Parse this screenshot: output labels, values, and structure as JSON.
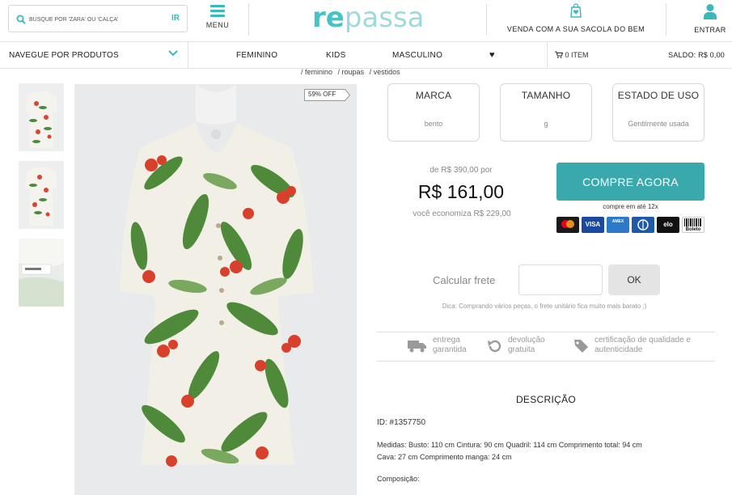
{
  "header": {
    "search_placeholder": "BUSQUE POR 'ZARA' OU 'CALÇA'",
    "search_go": "IR",
    "menu_label": "MENU",
    "logo_re": "re",
    "logo_rest": "passa",
    "sell_label": "VENDA COM A SUA SACOLA DO BEM",
    "login_label": "ENTRAR"
  },
  "nav": {
    "browse_label": "NAVEGUE POR PRODUTOS",
    "items": [
      "FEMININO",
      "KIDS",
      "MASCULINO"
    ],
    "cart_label": "0 ITEM",
    "balance_label": "SALDO: R$ 0,00"
  },
  "breadcrumb": [
    "/ feminino",
    "/ roupas",
    "/ vestidos"
  ],
  "product": {
    "discount_badge": "59% OFF",
    "attributes": [
      {
        "title": "MARCA",
        "value": "bento"
      },
      {
        "title": "TAMANHO",
        "value": "g"
      },
      {
        "title": "ESTADO DE USO",
        "value": "Gentilmente usada"
      }
    ],
    "old_price": "de R$ 390,00 por",
    "price": "R$ 161,00",
    "savings": "você economiza R$ 229,00",
    "buy_label": "COMPRE AGORA",
    "installments": "compre em até 12x",
    "payment_methods": [
      "MC",
      "VISA",
      "AMEX",
      "DINERS",
      "elo",
      "Boleto"
    ]
  },
  "shipping": {
    "label": "Calcular frete",
    "ok_label": "OK",
    "tip": "Dica: Comprando vários peças, o frete unitário fica muito mais barato ;)"
  },
  "benefits": [
    {
      "line1": "entrega",
      "line2": "garantida",
      "icon": "truck-icon"
    },
    {
      "line1": "devolução",
      "line2": "gratuita",
      "icon": "return-icon"
    },
    {
      "line1": "certificação de qualidade e",
      "line2": "autenticidade",
      "icon": "tag-icon"
    }
  ],
  "description": {
    "title": "DESCRIÇÃO",
    "id": "ID: #1357750",
    "measures_1": "Medidas: Busto: 110 cm Cintura: 90 cm Quadril: 114 cm Comprimento total: 94 cm",
    "measures_2": "Cava: 27 cm Comprimento manga: 24 cm",
    "composition": "Composição:"
  },
  "colors": {
    "accent": "#3cb8bd",
    "buy_button": "#3aa9ae"
  }
}
